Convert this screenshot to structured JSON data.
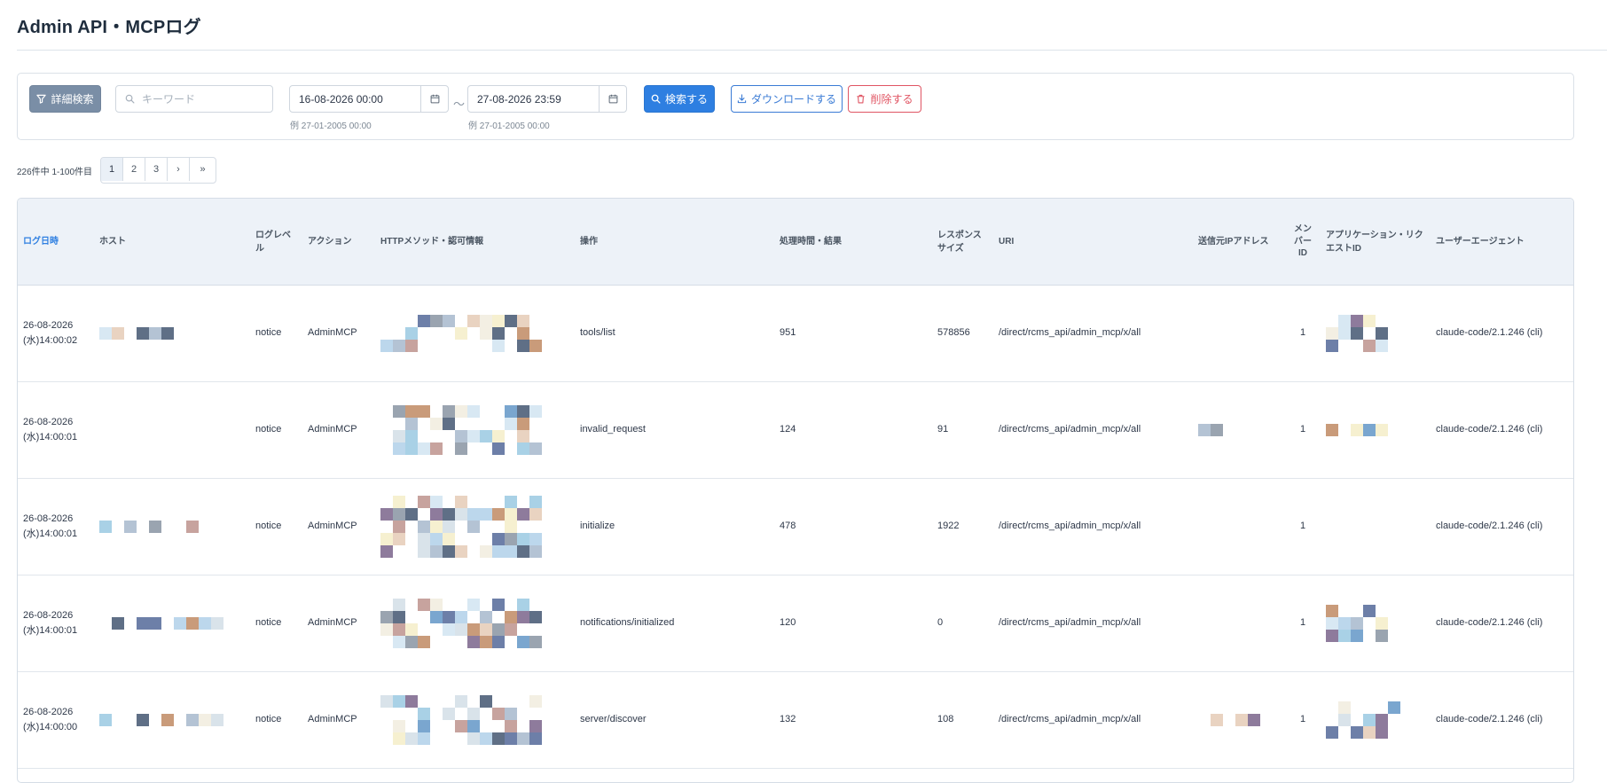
{
  "page": {
    "title": "Admin API・MCPログ"
  },
  "search": {
    "advanced_label": "詳細検索",
    "keyword_placeholder": "キーワード",
    "date_from": "16-08-2026 00:00",
    "date_to": "27-08-2026 23:59",
    "date_separator": "～",
    "date_hint": "例 27-01-2005 00:00",
    "search_label": "検索する",
    "download_label": "ダウンロードする",
    "delete_label": "削除する"
  },
  "pagination": {
    "summary": "226件中 1-100件目",
    "pages": [
      "1",
      "2",
      "3"
    ],
    "current": "1",
    "next": "›",
    "last": "»"
  },
  "table": {
    "headers": {
      "date": "ログ日時",
      "host": "ホスト",
      "level": "ログレベル",
      "action": "アクション",
      "method": "HTTPメソッド・認可情報",
      "operation": "操作",
      "duration": "処理時間・結果",
      "size": "レスポンスサイズ",
      "uri": "URI",
      "ip": "送信元IPアドレス",
      "member": "メンバーID",
      "app": "アプリケーション・リクエストID",
      "ua": "ユーザーエージェント"
    },
    "rows": [
      {
        "date": "26-08-2026(水)14:00:02",
        "level": "notice",
        "action": "AdminMCP",
        "operation": "tools/list",
        "duration": "951",
        "size": "578856",
        "uri": "/direct/rcms_api/admin_mcp/x/all",
        "member": "1",
        "ua": "claude-code/2.1.246 (cli)"
      },
      {
        "date": "26-08-2026(水)14:00:01",
        "level": "notice",
        "action": "AdminMCP",
        "operation": "invalid_request",
        "duration": "124",
        "size": "91",
        "uri": "/direct/rcms_api/admin_mcp/x/all",
        "member": "1",
        "ua": "claude-code/2.1.246 (cli)"
      },
      {
        "date": "26-08-2026(水)14:00:01",
        "level": "notice",
        "action": "AdminMCP",
        "operation": "initialize",
        "duration": "478",
        "size": "1922",
        "uri": "/direct/rcms_api/admin_mcp/x/all",
        "member": "1",
        "ua": "claude-code/2.1.246 (cli)"
      },
      {
        "date": "26-08-2026(水)14:00:01",
        "level": "notice",
        "action": "AdminMCP",
        "operation": "notifications/initialized",
        "duration": "120",
        "size": "0",
        "uri": "/direct/rcms_api/admin_mcp/x/all",
        "member": "1",
        "ua": "claude-code/2.1.246 (cli)"
      },
      {
        "date": "26-08-2026(水)14:00:00",
        "level": "notice",
        "action": "AdminMCP",
        "operation": "server/discover",
        "duration": "132",
        "size": "108",
        "uri": "/direct/rcms_api/admin_mcp/x/all",
        "member": "1",
        "ua": "claude-code/2.1.246 (cli)"
      }
    ]
  },
  "icons": {
    "advanced": "filter-icon",
    "keyword": "search-icon",
    "calendar": "calendar-icon",
    "search": "search-icon",
    "download": "download-icon",
    "delete": "trash-icon"
  },
  "colors": {
    "primary": "#2e7fe1",
    "danger": "#e05563",
    "advanced_button": "#7a8ea6",
    "header_bg": "#edf2f8",
    "sorted_header": "#2e7fe1"
  }
}
